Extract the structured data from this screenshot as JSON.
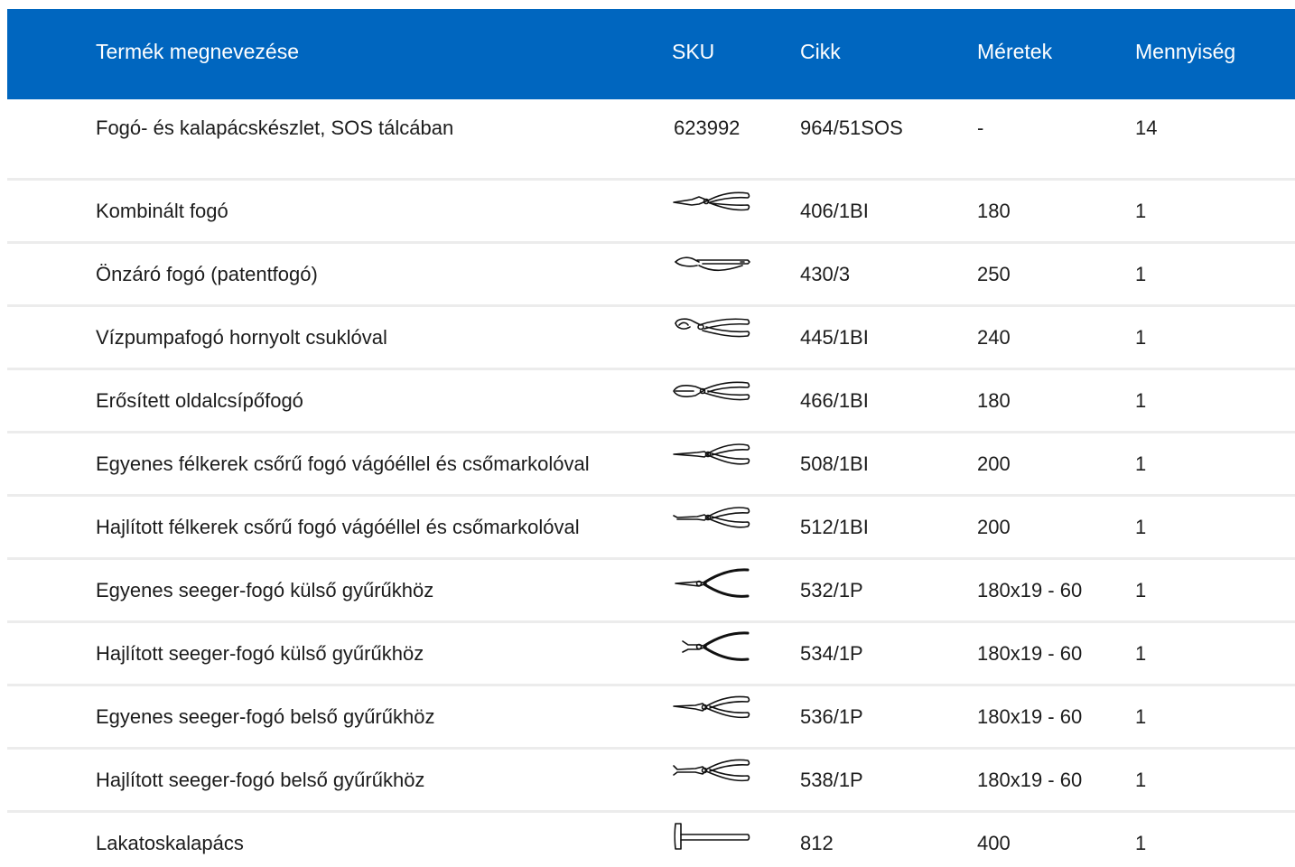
{
  "header": {
    "name": "Termék megnevezése",
    "sku": "SKU",
    "cikk": "Cikk",
    "size": "Méretek",
    "qty": "Mennyiség"
  },
  "colors": {
    "header_bg": "#0066bf",
    "header_text": "#ffffff",
    "divider": "#ececec"
  },
  "rows": [
    {
      "name": "Fogó- és kalapácskészlet, SOS tálcában",
      "sku": "623992",
      "cikk": "964/51SOS",
      "size": "-",
      "qty": "14"
    },
    {
      "name": "Kombinált fogó",
      "icon": "combination-pliers-icon",
      "cikk": "406/1BI",
      "size": "180",
      "qty": "1"
    },
    {
      "name": "Önzáró fogó (patentfogó)",
      "icon": "locking-pliers-icon",
      "cikk": "430/3",
      "size": "250",
      "qty": "1"
    },
    {
      "name": "Vízpumpafogó hornyolt csuklóval",
      "icon": "water-pump-pliers-icon",
      "cikk": "445/1BI",
      "size": "240",
      "qty": "1"
    },
    {
      "name": "Erősített oldalcsípőfogó",
      "icon": "diagonal-cutter-icon",
      "cikk": "466/1BI",
      "size": "180",
      "qty": "1"
    },
    {
      "name": "Egyenes félkerek csőrű fogó vágóéllel és csőmarkolóval",
      "icon": "straight-nose-pliers-icon",
      "cikk": "508/1BI",
      "size": "200",
      "qty": "1"
    },
    {
      "name": "Hajlított félkerek csőrű fogó vágóéllel és csőmarkolóval",
      "icon": "bent-nose-pliers-icon",
      "cikk": "512/1BI",
      "size": "200",
      "qty": "1"
    },
    {
      "name": "Egyenes seeger-fogó külső gyűrűkhöz",
      "icon": "external-circlip-pliers-icon",
      "cikk": "532/1P",
      "size": "180x19 - 60",
      "qty": "1"
    },
    {
      "name": "Hajlított seeger-fogó külső gyűrűkhöz",
      "icon": "bent-external-circlip-pliers-icon",
      "cikk": "534/1P",
      "size": "180x19 - 60",
      "qty": "1"
    },
    {
      "name": "Egyenes seeger-fogó belső gyűrűkhöz",
      "icon": "internal-circlip-pliers-icon",
      "cikk": "536/1P",
      "size": "180x19 - 60",
      "qty": "1"
    },
    {
      "name": "Hajlított seeger-fogó belső gyűrűkhöz",
      "icon": "bent-internal-circlip-pliers-icon",
      "cikk": "538/1P",
      "size": "180x19 - 60",
      "qty": "1"
    },
    {
      "name": "Lakatoskalapács",
      "icon": "hammer-icon",
      "cikk": "812",
      "size": "400",
      "qty": "1"
    }
  ]
}
